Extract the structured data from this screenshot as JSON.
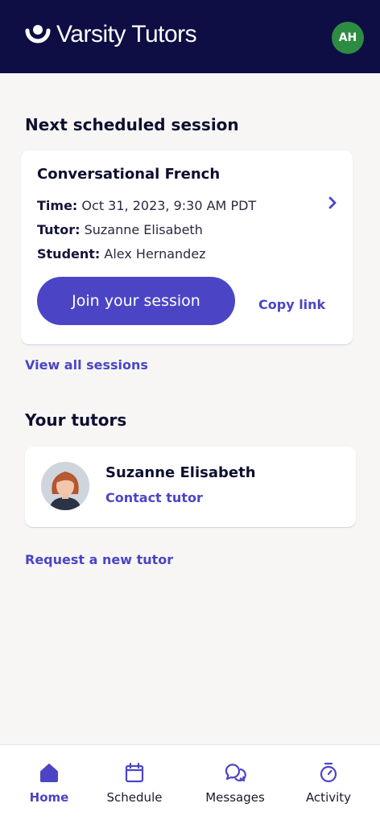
{
  "header": {
    "brand": "Varsity Tutors",
    "avatar_initials": "AH",
    "avatar_color": "#2e8b42",
    "background": "#0e0e44"
  },
  "next_session": {
    "section_title": "Next scheduled session",
    "course": "Conversational French",
    "time_label": "Time:",
    "time_value": "Oct 31, 2023, 9:30 AM PDT",
    "tutor_label": "Tutor:",
    "tutor_value": "Suzanne Elisabeth",
    "student_label": "Student:",
    "student_value": "Alex Hernandez",
    "join_label": "Join your session",
    "copy_link_label": "Copy link",
    "view_all_label": "View all sessions"
  },
  "tutors": {
    "section_title": "Your tutors",
    "items": [
      {
        "name": "Suzanne Elisabeth",
        "contact_label": "Contact tutor",
        "photo_icon": "tutor-photo"
      }
    ],
    "request_label": "Request a new tutor"
  },
  "bottom_nav": {
    "items": [
      {
        "label": "Home",
        "icon": "home-icon",
        "active": true
      },
      {
        "label": "Schedule",
        "icon": "calendar-icon",
        "active": false
      },
      {
        "label": "Messages",
        "icon": "chat-bubbles-icon",
        "active": false
      },
      {
        "label": "Activity",
        "icon": "stopwatch-icon",
        "active": false
      }
    ]
  },
  "colors": {
    "accent": "#4b45c6",
    "page_background": "#f7f6f4"
  }
}
